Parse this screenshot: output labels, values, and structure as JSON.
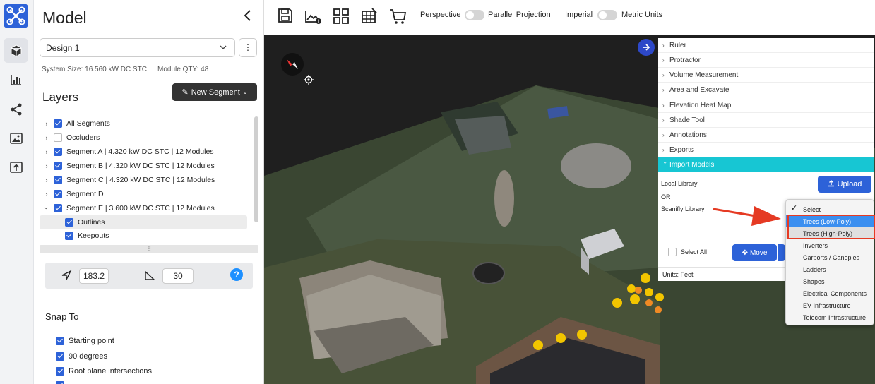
{
  "panel": {
    "title": "Model",
    "design_select": "Design 1",
    "system_size": "System Size: 16.560 kW DC STC",
    "module_qty": "Module QTY: 48",
    "layers_title": "Layers",
    "new_segment_label": "New Segment",
    "layers": [
      {
        "label": "All Segments",
        "checked": true,
        "arrow": "right"
      },
      {
        "label": "Occluders",
        "checked": false,
        "arrow": "right"
      },
      {
        "label": "Segment A | 4.320 kW DC STC | 12 Modules",
        "checked": true,
        "arrow": "right"
      },
      {
        "label": "Segment B | 4.320 kW DC STC | 12 Modules",
        "checked": true,
        "arrow": "right"
      },
      {
        "label": "Segment C | 4.320 kW DC STC | 12 Modules",
        "checked": true,
        "arrow": "right"
      },
      {
        "label": "Segment D",
        "checked": true,
        "arrow": "right"
      },
      {
        "label": "Segment E | 3.600 kW DC STC | 12 Modules",
        "checked": true,
        "arrow": "down"
      },
      {
        "label": "Outlines",
        "checked": true,
        "arrow": ""
      },
      {
        "label": "Keepouts",
        "checked": true,
        "arrow": ""
      }
    ],
    "azimuth": "183.2",
    "pitch": "30",
    "snap_title": "Snap To",
    "snap_items": [
      "Starting point",
      "90 degrees",
      "Roof plane intersections"
    ]
  },
  "toolbar": {
    "perspective": "Perspective",
    "parallel": "Parallel Projection",
    "imperial": "Imperial",
    "metric": "Metric Units"
  },
  "tools": {
    "items": [
      "Ruler",
      "Protractor",
      "Volume Measurement",
      "Area and Excavate",
      "Elevation Heat Map",
      "Shade Tool",
      "Annotations",
      "Exports",
      "Import Models"
    ],
    "local_library": "Local Library",
    "or": "OR",
    "scanifly_library": "Scanifly Library",
    "upload": "Upload",
    "select_all": "Select All",
    "move": "Move",
    "units": "Units: Feet"
  },
  "dropdown": {
    "items": [
      "Select",
      "Trees (Low-Poly)",
      "Trees (High-Poly)",
      "Inverters",
      "Carports / Canopies",
      "Ladders",
      "Shapes",
      "Electrical Components",
      "EV Infrastructure",
      "Telecom Infrastructure"
    ]
  },
  "colors": {
    "brand_blue": "#2d62d8",
    "accent_cyan": "#17c6d3",
    "annotation_red": "#e53a23"
  }
}
